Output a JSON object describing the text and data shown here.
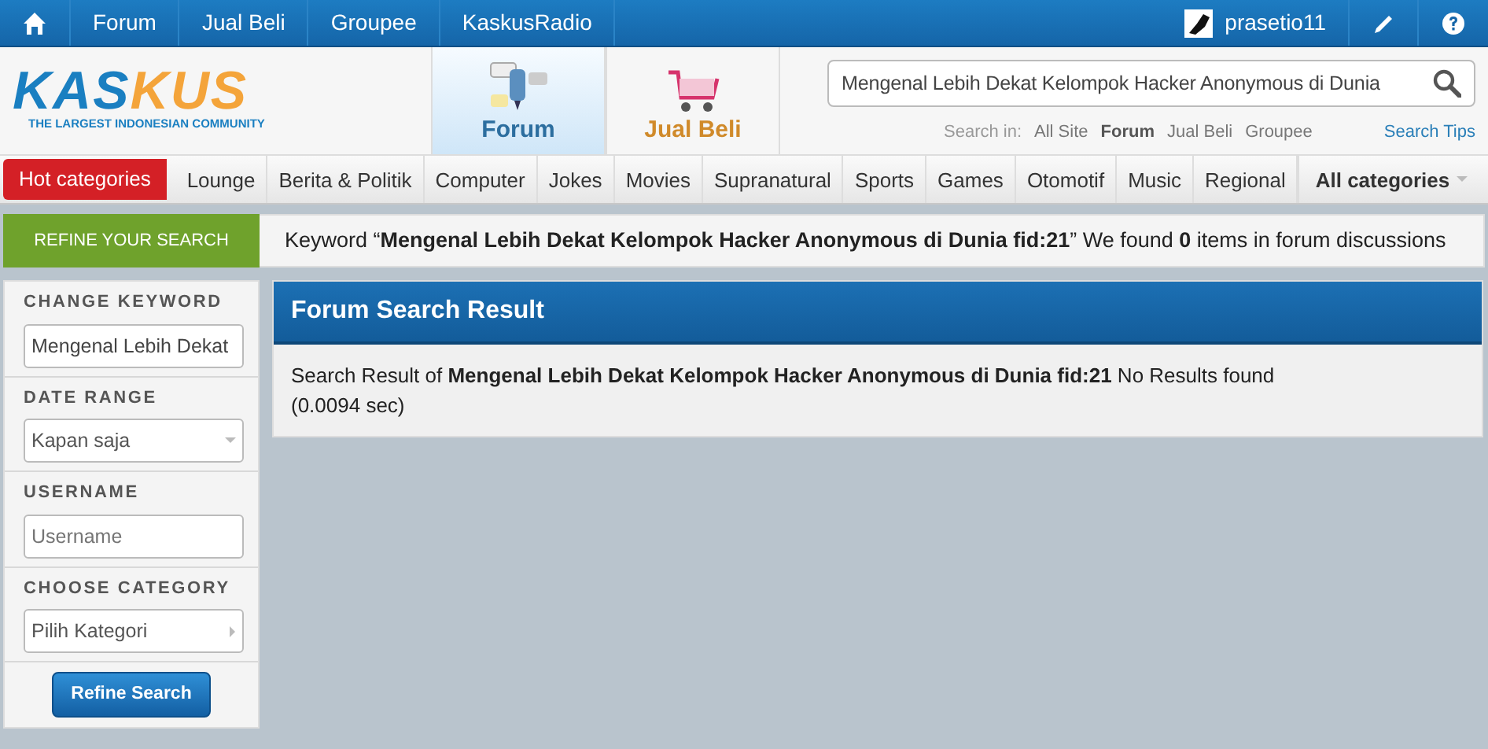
{
  "top_nav": {
    "links": [
      "Forum",
      "Jual Beli",
      "Groupee",
      "KaskusRadio"
    ],
    "username": "prasetio11"
  },
  "logo": {
    "text": "KASKUS",
    "tagline": "THE LARGEST INDONESIAN COMMUNITY"
  },
  "sections": [
    {
      "label": "Forum",
      "kind": "forum",
      "selected": true
    },
    {
      "label": "Jual Beli",
      "kind": "shop",
      "selected": false
    }
  ],
  "search": {
    "value": "Mengenal Lebih Dekat Kelompok Hacker Anonymous di Dunia",
    "scope_label": "Search in:",
    "scopes": [
      {
        "label": "All Site",
        "selected": false
      },
      {
        "label": "Forum",
        "selected": true
      },
      {
        "label": "Jual Beli",
        "selected": false
      },
      {
        "label": "Groupee",
        "selected": false
      }
    ],
    "tips": "Search Tips"
  },
  "categories": {
    "hot": "Hot categories",
    "items": [
      "Lounge",
      "Berita & Politik",
      "Computer",
      "Jokes",
      "Movies",
      "Supranatural",
      "Sports",
      "Games",
      "Otomotif",
      "Music",
      "Regional"
    ],
    "all": "All categories"
  },
  "refine_tab": "REFINE YOUR SEARCH",
  "summary": "Keyword “**Mengenal Lebih Dekat Kelompok Hacker Anonymous di Dunia fid:21**” We found **0** items in forum discussions",
  "sidebar": {
    "fields": [
      {
        "label": "CHANGE KEYWORD",
        "kind": "text",
        "value": "Mengenal Lebih Dekat"
      },
      {
        "label": "DATE RANGE",
        "kind": "dropdown",
        "value": "Kapan saja"
      },
      {
        "label": "USERNAME",
        "kind": "text",
        "placeholder": "Username"
      },
      {
        "label": "CHOOSE CATEGORY",
        "kind": "submenu",
        "value": "Pilih Kategori"
      }
    ],
    "button": "Refine Search"
  },
  "result": {
    "title": "Forum Search Result",
    "text": "Search Result of **Mengenal Lebih Dekat Kelompok Hacker Anonymous di Dunia fid:21** No Results found",
    "time": "(0.0094 sec)"
  }
}
